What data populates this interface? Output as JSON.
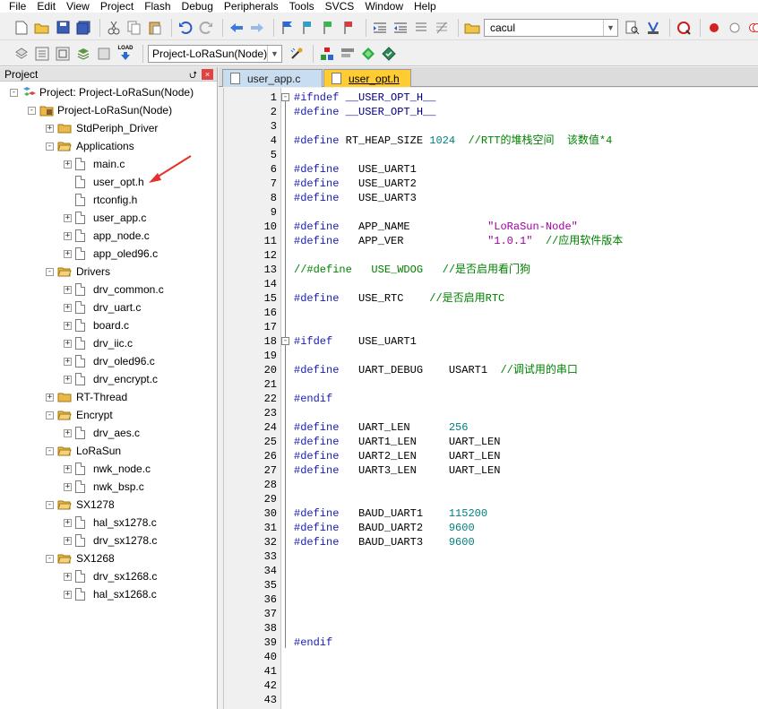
{
  "menu": [
    "File",
    "Edit",
    "View",
    "Project",
    "Flash",
    "Debug",
    "Peripherals",
    "Tools",
    "SVCS",
    "Window",
    "Help"
  ],
  "toolbar1": {
    "find_value": "cacul"
  },
  "toolbar2": {
    "target_value": "Project-LoRaSun(Node)",
    "load_label": "LOAD"
  },
  "project_panel": {
    "title": "Project",
    "pin_glyph": "⮍",
    "close_glyph": "×",
    "root": "Project: Project-LoRaSun(Node)",
    "target": "Project-LoRaSun(Node)",
    "groups": [
      {
        "name": "StdPeriph_Driver",
        "expanded": false,
        "files": []
      },
      {
        "name": "Applications",
        "expanded": true,
        "files": [
          {
            "name": "main.c",
            "expander": true
          },
          {
            "name": "user_opt.h",
            "expander": false
          },
          {
            "name": "rtconfig.h",
            "expander": false
          },
          {
            "name": "user_app.c",
            "expander": true
          },
          {
            "name": "app_node.c",
            "expander": true
          },
          {
            "name": "app_oled96.c",
            "expander": true
          }
        ]
      },
      {
        "name": "Drivers",
        "expanded": true,
        "files": [
          {
            "name": "drv_common.c",
            "expander": true
          },
          {
            "name": "drv_uart.c",
            "expander": true
          },
          {
            "name": "board.c",
            "expander": true
          },
          {
            "name": "drv_iic.c",
            "expander": true
          },
          {
            "name": "drv_oled96.c",
            "expander": true
          },
          {
            "name": "drv_encrypt.c",
            "expander": true
          }
        ]
      },
      {
        "name": "RT-Thread",
        "expanded": false,
        "files": []
      },
      {
        "name": "Encrypt",
        "expanded": true,
        "files": [
          {
            "name": "drv_aes.c",
            "expander": true
          }
        ]
      },
      {
        "name": "LoRaSun",
        "expanded": true,
        "files": [
          {
            "name": "nwk_node.c",
            "expander": true
          },
          {
            "name": "nwk_bsp.c",
            "expander": true
          }
        ]
      },
      {
        "name": "SX1278",
        "expanded": true,
        "files": [
          {
            "name": "hal_sx1278.c",
            "expander": true
          },
          {
            "name": "drv_sx1278.c",
            "expander": true
          }
        ]
      },
      {
        "name": "SX1268",
        "expanded": true,
        "files": [
          {
            "name": "drv_sx1268.c",
            "expander": true
          },
          {
            "name": "hal_sx1268.c",
            "expander": true
          }
        ]
      }
    ]
  },
  "editor": {
    "tabs": [
      {
        "label": "user_app.c",
        "active": false
      },
      {
        "label": "user_opt.h",
        "active": true
      }
    ],
    "lines": [
      {
        "n": "1",
        "parts": [
          [
            "pp",
            "#ifndef"
          ],
          [
            "t",
            " "
          ],
          [
            "id",
            "__USER_OPT_H__"
          ]
        ]
      },
      {
        "n": "2",
        "parts": [
          [
            "pp",
            "#define"
          ],
          [
            "t",
            " "
          ],
          [
            "id",
            "__USER_OPT_H__"
          ]
        ]
      },
      {
        "n": "3",
        "parts": []
      },
      {
        "n": "4",
        "parts": [
          [
            "pp",
            "#define"
          ],
          [
            "t",
            " RT_HEAP_SIZE "
          ],
          [
            "num",
            "1024"
          ],
          [
            "t",
            "  "
          ],
          [
            "cmt",
            "//RTT的堆栈空间  该数值*4"
          ]
        ]
      },
      {
        "n": "5",
        "parts": []
      },
      {
        "n": "6",
        "parts": [
          [
            "pp",
            "#define"
          ],
          [
            "t",
            "   USE_UART1"
          ]
        ]
      },
      {
        "n": "7",
        "parts": [
          [
            "pp",
            "#define"
          ],
          [
            "t",
            "   USE_UART2"
          ]
        ]
      },
      {
        "n": "8",
        "parts": [
          [
            "pp",
            "#define"
          ],
          [
            "t",
            "   USE_UART3"
          ]
        ]
      },
      {
        "n": "9",
        "parts": []
      },
      {
        "n": "10",
        "parts": [
          [
            "pp",
            "#define"
          ],
          [
            "t",
            "   APP_NAME            "
          ],
          [
            "str",
            "\"LoRaSun-Node\""
          ]
        ]
      },
      {
        "n": "11",
        "parts": [
          [
            "pp",
            "#define"
          ],
          [
            "t",
            "   APP_VER             "
          ],
          [
            "str",
            "\"1.0.1\""
          ],
          [
            "t",
            "  "
          ],
          [
            "cmt",
            "//应用软件版本"
          ]
        ]
      },
      {
        "n": "12",
        "parts": []
      },
      {
        "n": "13",
        "parts": [
          [
            "cmt",
            "//#define   USE_WDOG   //是否启用看门狗"
          ]
        ]
      },
      {
        "n": "14",
        "parts": []
      },
      {
        "n": "15",
        "parts": [
          [
            "pp",
            "#define"
          ],
          [
            "t",
            "   USE_RTC    "
          ],
          [
            "cmt",
            "//是否启用RTC"
          ]
        ]
      },
      {
        "n": "16",
        "parts": []
      },
      {
        "n": "17",
        "parts": []
      },
      {
        "n": "18",
        "parts": [
          [
            "pp",
            "#ifdef"
          ],
          [
            "t",
            "    USE_UART1"
          ]
        ]
      },
      {
        "n": "19",
        "parts": []
      },
      {
        "n": "20",
        "parts": [
          [
            "pp",
            "#define"
          ],
          [
            "t",
            "   UART_DEBUG    USART1  "
          ],
          [
            "cmt",
            "//调试用的串口"
          ]
        ]
      },
      {
        "n": "21",
        "parts": []
      },
      {
        "n": "22",
        "parts": [
          [
            "pp",
            "#endif"
          ]
        ]
      },
      {
        "n": "23",
        "parts": []
      },
      {
        "n": "24",
        "parts": [
          [
            "pp",
            "#define"
          ],
          [
            "t",
            "   UART_LEN      "
          ],
          [
            "num",
            "256"
          ]
        ]
      },
      {
        "n": "25",
        "parts": [
          [
            "pp",
            "#define"
          ],
          [
            "t",
            "   UART1_LEN     UART_LEN"
          ]
        ]
      },
      {
        "n": "26",
        "parts": [
          [
            "pp",
            "#define"
          ],
          [
            "t",
            "   UART2_LEN     UART_LEN"
          ]
        ]
      },
      {
        "n": "27",
        "parts": [
          [
            "pp",
            "#define"
          ],
          [
            "t",
            "   UART3_LEN     UART_LEN"
          ]
        ]
      },
      {
        "n": "28",
        "parts": []
      },
      {
        "n": "29",
        "parts": []
      },
      {
        "n": "30",
        "parts": [
          [
            "pp",
            "#define"
          ],
          [
            "t",
            "   BAUD_UART1    "
          ],
          [
            "num",
            "115200"
          ]
        ]
      },
      {
        "n": "31",
        "parts": [
          [
            "pp",
            "#define"
          ],
          [
            "t",
            "   BAUD_UART2    "
          ],
          [
            "num",
            "9600"
          ]
        ]
      },
      {
        "n": "32",
        "parts": [
          [
            "pp",
            "#define"
          ],
          [
            "t",
            "   BAUD_UART3    "
          ],
          [
            "num",
            "9600"
          ]
        ]
      },
      {
        "n": "33",
        "parts": []
      },
      {
        "n": "34",
        "parts": []
      },
      {
        "n": "35",
        "parts": []
      },
      {
        "n": "36",
        "parts": []
      },
      {
        "n": "37",
        "parts": []
      },
      {
        "n": "38",
        "parts": []
      },
      {
        "n": "39",
        "parts": [
          [
            "pp",
            "#endif"
          ]
        ]
      },
      {
        "n": "40",
        "parts": []
      },
      {
        "n": "41",
        "parts": []
      },
      {
        "n": "42",
        "parts": []
      },
      {
        "n": "43",
        "parts": []
      }
    ]
  },
  "colors": {
    "preprocessor": "#1a1ab0",
    "number": "#008080",
    "string": "#a000a0",
    "comment": "#008000",
    "active_tab": "#ffcc33",
    "annotation_arrow": "#e8302a"
  }
}
